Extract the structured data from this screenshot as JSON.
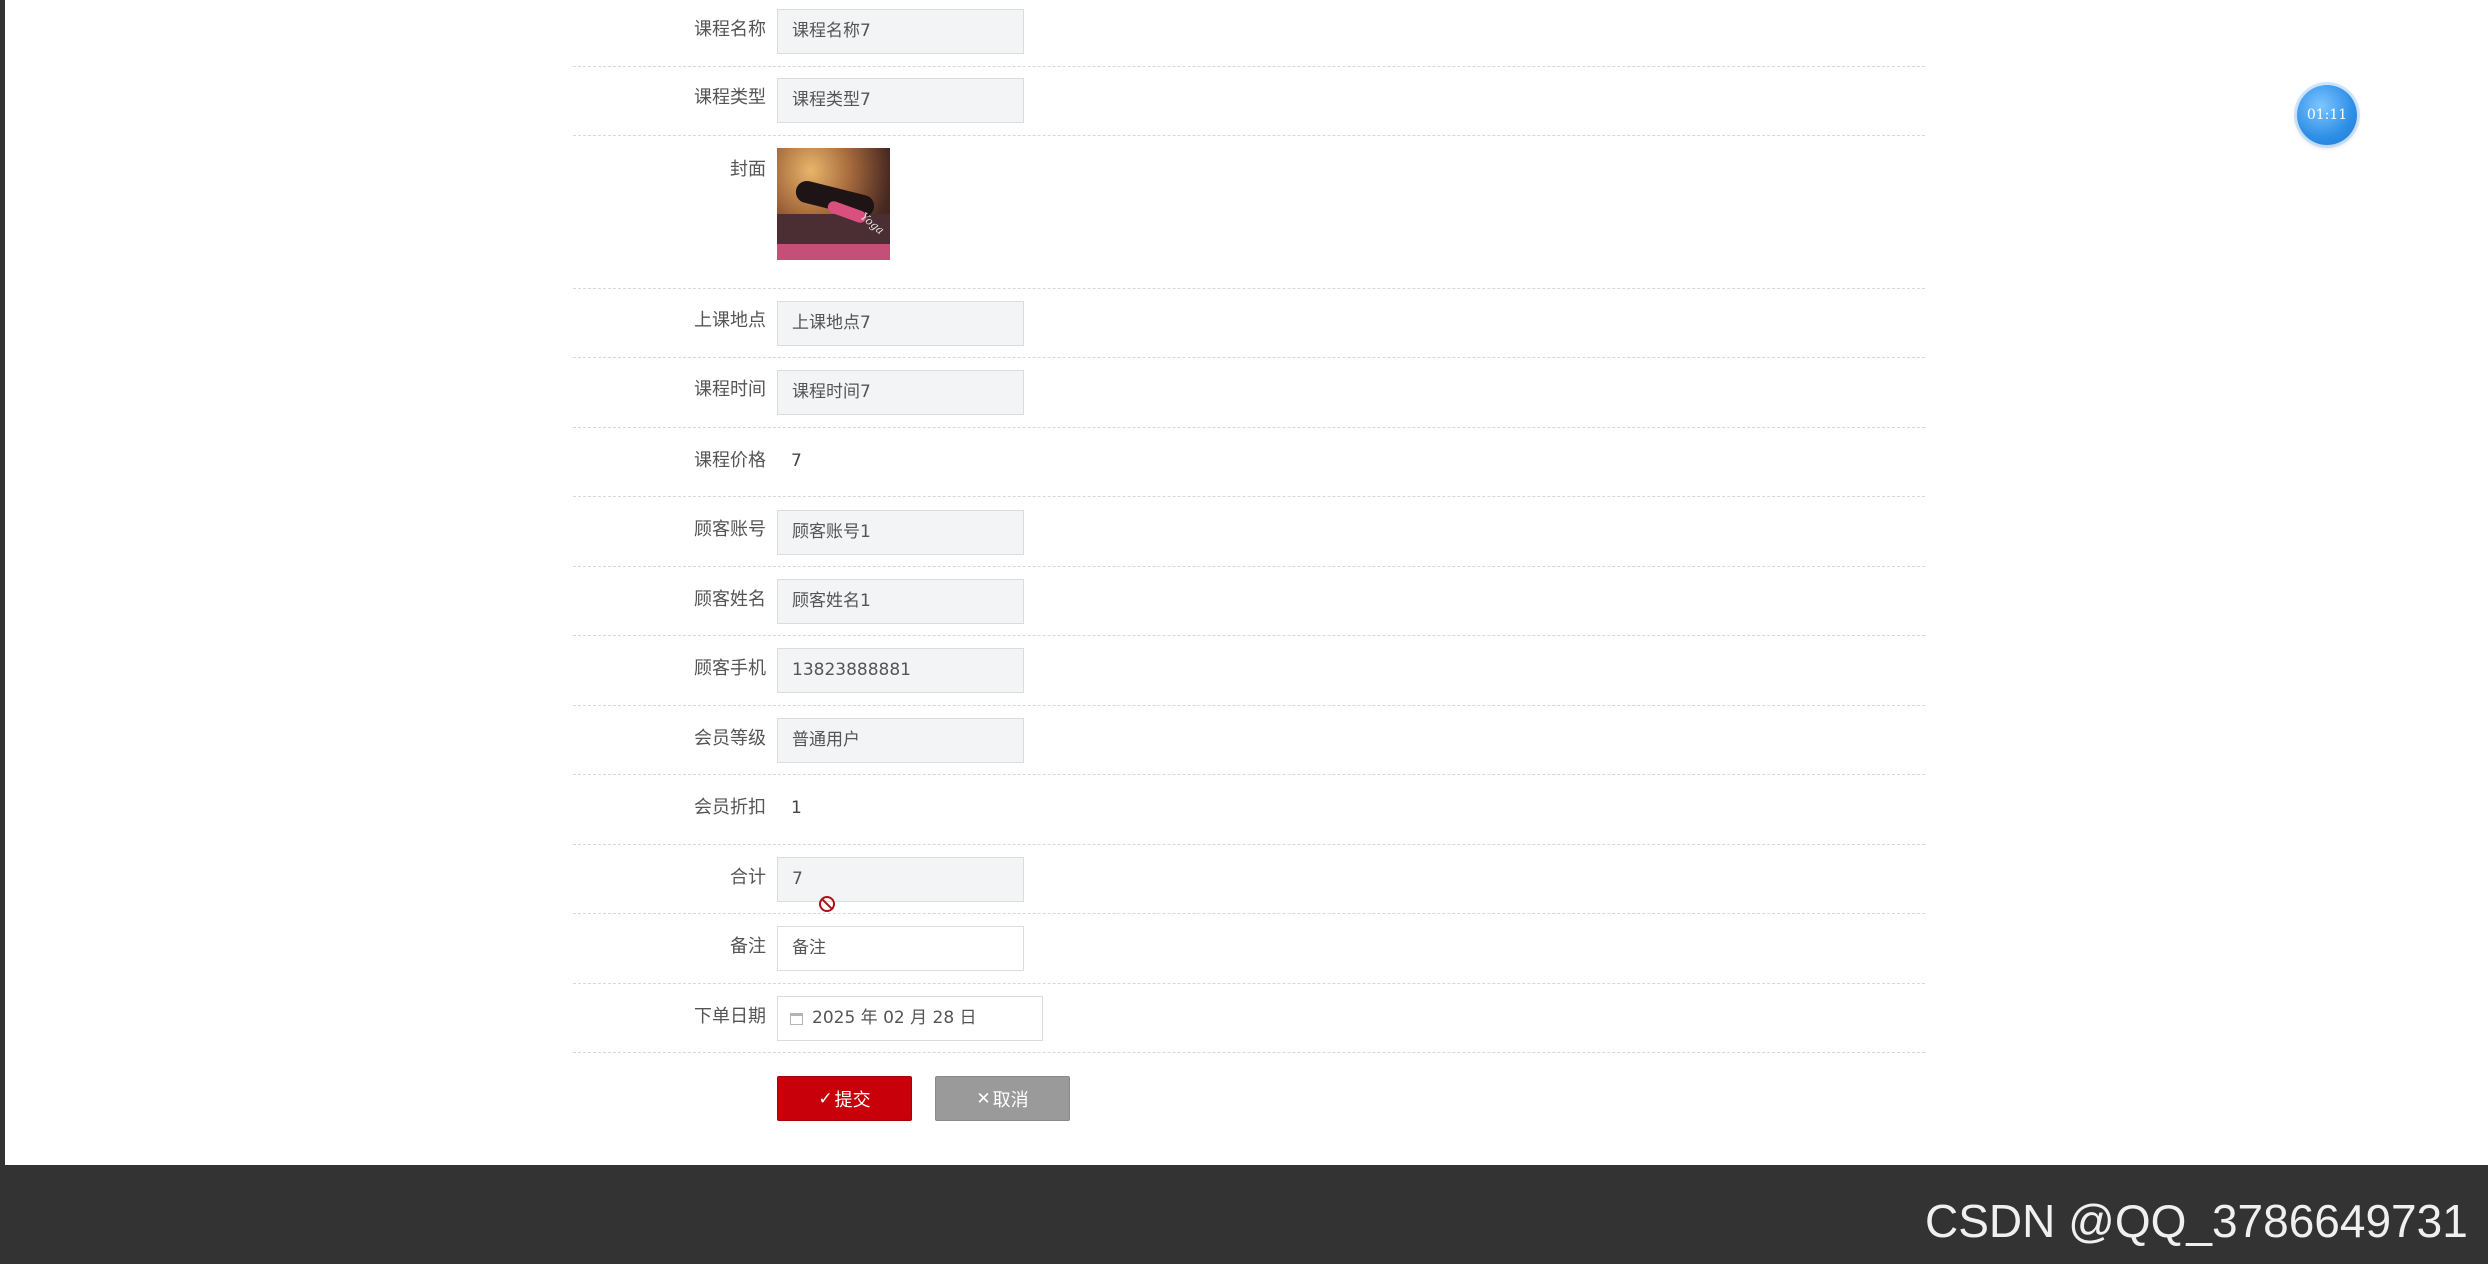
{
  "form": {
    "course_name": {
      "label": "课程名称",
      "value": "课程名称7"
    },
    "course_type": {
      "label": "课程类型",
      "value": "课程类型7"
    },
    "cover": {
      "label": "封面",
      "image_text": "Yoga"
    },
    "location": {
      "label": "上课地点",
      "value": "上课地点7"
    },
    "course_time": {
      "label": "课程时间",
      "value": "课程时间7"
    },
    "course_price": {
      "label": "课程价格",
      "value": "7"
    },
    "customer_account": {
      "label": "顾客账号",
      "value": "顾客账号1"
    },
    "customer_name": {
      "label": "顾客姓名",
      "value": "顾客姓名1"
    },
    "customer_phone": {
      "label": "顾客手机",
      "value": "13823888881"
    },
    "member_level": {
      "label": "会员等级",
      "value": "普通用户"
    },
    "member_discount": {
      "label": "会员折扣",
      "value": "1"
    },
    "total": {
      "label": "合计",
      "value": "7"
    },
    "remark": {
      "label": "备注",
      "value": "备注"
    },
    "order_date": {
      "label": "下单日期",
      "value": "2025 年 02 月 28 日"
    }
  },
  "actions": {
    "submit_label": "提交",
    "cancel_label": "取消"
  },
  "timer": "01:11",
  "watermark": "CSDN @QQ_3786649731",
  "colors": {
    "submit": "#c8000a",
    "cancel": "#9a9a9a",
    "background": "#333333",
    "timer": "#2e8fe6"
  }
}
